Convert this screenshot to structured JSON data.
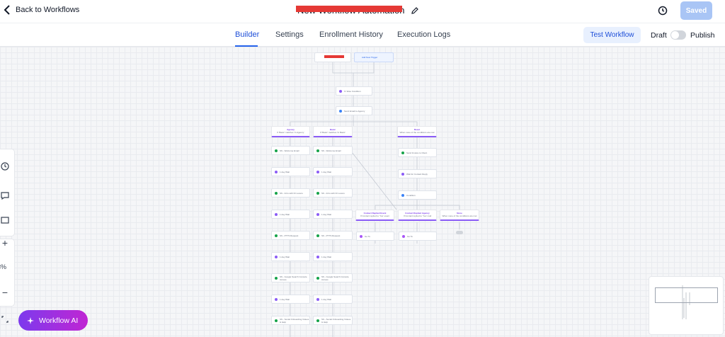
{
  "header": {
    "back_label": "Back to Workflows",
    "workflow_title": "New Workflow Automation",
    "saved_label": "Saved"
  },
  "tabs": [
    {
      "label": "Builder",
      "active": true
    },
    {
      "label": "Settings",
      "active": false
    },
    {
      "label": "Enrollment History",
      "active": false
    },
    {
      "label": "Execution Logs",
      "active": false
    }
  ],
  "actions": {
    "test_label": "Test Workflow",
    "draft_label": "Draft",
    "publish_label": "Publish",
    "published": false
  },
  "canvas": {
    "add_trigger_label": "Add New Trigger",
    "nodes": {
      "n1": "If / Else Condition",
      "n2": "Send Email to Agency",
      "left_col": [
        "SS - Welcome Email",
        "1 day Wait",
        "SS - Intro with Dr Lucero",
        "1 day Wait",
        "SS - PTTS Request",
        "1 day Wait",
        "SS - Google Search Console Access",
        "1 day Wait",
        "SS - Social Onboarding Videos & Help"
      ],
      "mid_col": [
        "SS - Welcome Email",
        "1 day Wait",
        "SS - Intro with Dr Lucero",
        "1 day Wait",
        "SS - PTTS Request",
        "1 day Wait",
        "SS - Google Search Console Access",
        "1 day Wait",
        "SS - Social Onboarding Videos & Help"
      ],
      "right_col": [
        "Send Invoice to Client",
        "Wait for Contact Reply",
        "Condition"
      ],
      "lower": [
        "Go To",
        "Go To"
      ]
    },
    "branches": {
      "b1": {
        "title": "Agency",
        "sub": "If 'Basic' matches 'In Agency'"
      },
      "b2": {
        "title": "Basic",
        "sub": "If 'Basic' matches 'In Basic'"
      },
      "b3": {
        "title": "Reset",
        "sub": "When none of the conditions are met"
      },
      "b4": {
        "title": "Contact Replied Event",
        "sub": "If Contact replied to 'Yes' event"
      },
      "b5": {
        "title": "Contact Replied Agency",
        "sub": "If Contact replied to 'Yes' mail"
      },
      "b6": {
        "title": "None",
        "sub": "When none of the conditions are met"
      }
    },
    "end_label": "END"
  },
  "left_toolbar": {
    "zoom_label": "3%"
  },
  "ai_button_label": "Workflow AI",
  "icons": [
    "chevron-left-icon",
    "pencil-icon",
    "history-icon",
    "sparkle-icon",
    "plus-icon",
    "minus-icon",
    "fit-screen-icon",
    "comment-icon",
    "note-icon"
  ]
}
